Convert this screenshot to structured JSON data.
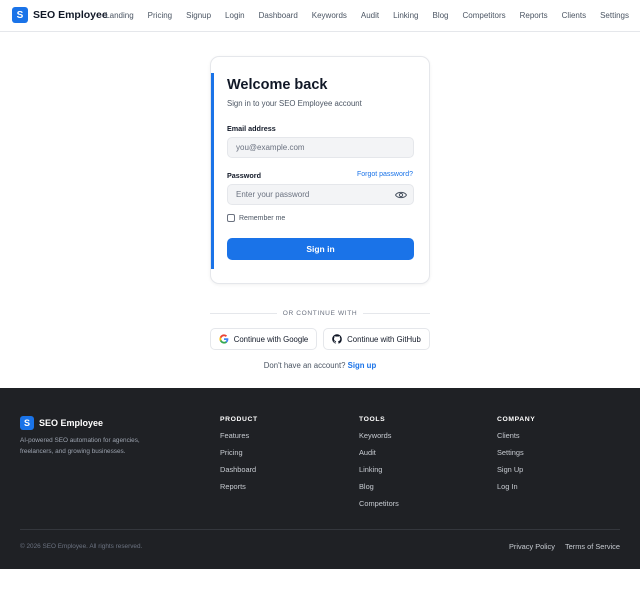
{
  "header": {
    "logo_letter": "S",
    "brand": "SEO Employee",
    "nav": [
      "Landing",
      "Pricing",
      "Signup",
      "Login",
      "Dashboard",
      "Keywords",
      "Audit",
      "Linking",
      "Blog",
      "Competitors",
      "Reports",
      "Clients",
      "Settings"
    ]
  },
  "login": {
    "title": "Welcome back",
    "subtitle": "Sign in to your SEO Employee account",
    "email_label": "Email address",
    "email_placeholder": "you@example.com",
    "password_label": "Password",
    "forgot_label": "Forgot password?",
    "password_placeholder": "Enter your password",
    "remember_label": "Remember me",
    "submit_label": "Sign in"
  },
  "alt": {
    "divider": "OR CONTINUE WITH",
    "google": "Continue with Google",
    "github": "Continue with GitHub",
    "signup_prompt": "Don't have an account?",
    "signup_link": "Sign up"
  },
  "footer": {
    "logo_letter": "S",
    "brand": "SEO Employee",
    "description": "AI-powered SEO automation for agencies, freelancers, and growing businesses.",
    "columns": [
      {
        "title": "PRODUCT",
        "links": [
          "Features",
          "Pricing",
          "Dashboard",
          "Reports"
        ]
      },
      {
        "title": "TOOLS",
        "links": [
          "Keywords",
          "Audit",
          "Linking",
          "Blog",
          "Competitors"
        ]
      },
      {
        "title": "COMPANY",
        "links": [
          "Clients",
          "Settings",
          "Sign Up",
          "Log In"
        ]
      }
    ],
    "copyright": "© 2026 SEO Employee. All rights reserved.",
    "legal": [
      "Privacy Policy",
      "Terms of Service"
    ]
  },
  "colors": {
    "accent": "#1a73e8",
    "footer_bg": "#1f2125"
  },
  "icons": [
    "eye-icon",
    "google-icon",
    "github-icon"
  ]
}
